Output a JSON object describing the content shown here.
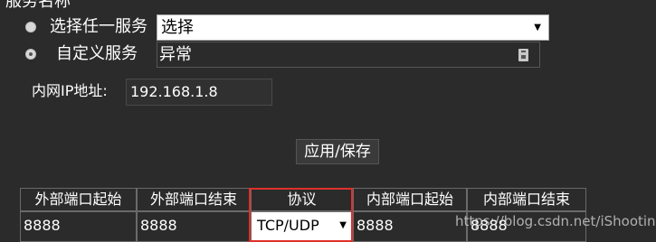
{
  "form": {
    "service_name_label": "服务名称",
    "option_any": {
      "label": "选择任一服务",
      "select_value": "选择"
    },
    "option_custom": {
      "label": "自定义服务",
      "value": "异常"
    },
    "ip": {
      "label": "内网IP地址:",
      "value": "192.168.1.8"
    },
    "apply_label": "应用/保存"
  },
  "table": {
    "headers": [
      "外部端口起始",
      "外部端口结束",
      "协议",
      "内部端口起始",
      "内部端口结束"
    ],
    "row": {
      "ext_start": "8888",
      "ext_end": "8888",
      "protocol": "TCP/UDP",
      "int_start": "8888",
      "int_end": "8888"
    }
  },
  "watermark": "https://blog.csdn.net/iShooting",
  "colors": {
    "background": "#2b2b2b",
    "highlight": "#e0302a"
  },
  "icons": {
    "dropdown": "triangle-down",
    "keyboard": "keyboard-icon"
  }
}
